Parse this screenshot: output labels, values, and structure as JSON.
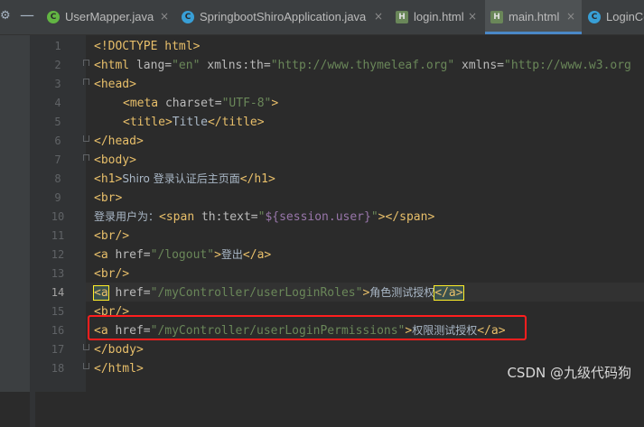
{
  "tabs": [
    {
      "label": "UserMapper.java",
      "icon": "class-icon",
      "icon_char": "C",
      "icon_color": "#62b543",
      "active": false
    },
    {
      "label": "SpringbootShiroApplication.java",
      "icon": "spring-class-icon",
      "icon_char": "C",
      "icon_color": "#389fd6",
      "active": false
    },
    {
      "label": "login.html",
      "icon": "html-file-icon",
      "icon_char": "H",
      "icon_color": "#6a8759",
      "active": false
    },
    {
      "label": "main.html",
      "icon": "html-file-icon",
      "icon_char": "H",
      "icon_color": "#6a8759",
      "active": true
    },
    {
      "label": "LoginCo",
      "icon": "class-icon",
      "icon_char": "C",
      "icon_color": "#389fd6",
      "active": false
    }
  ],
  "tab_close_glyph": "×",
  "line_numbers": [
    "1",
    "2",
    "3",
    "4",
    "5",
    "6",
    "7",
    "8",
    "9",
    "10",
    "11",
    "12",
    "13",
    "14",
    "15",
    "16",
    "17",
    "18"
  ],
  "current_line": "14",
  "code": {
    "l1": "<!DOCTYPE html>",
    "l2_tag": "<html",
    "l2_attr1": " lang=",
    "l2_val1": "\"en\"",
    "l2_attr2": " xmlns:th=",
    "l2_val2": "\"http://www.thymeleaf.org\"",
    "l2_attr3": " xmlns=",
    "l2_val3": "\"http://www.w3.org",
    "l3": "<head>",
    "l4_tag": "<meta",
    "l4_attr": " charset=",
    "l4_val": "\"UTF-8\"",
    "l4_end": ">",
    "l5_open": "<title>",
    "l5_text": "Title",
    "l5_close": "</title>",
    "l6": "</head>",
    "l7": "<body>",
    "l8_open": "<h1>",
    "l8_text": "Shiro 登录认证后主页面",
    "l8_close": "</h1>",
    "l9": "<br>",
    "l10_text": "登录用户为：",
    "l10_tag": "<span",
    "l10_attr": " th:text=",
    "l10_q1": "\"",
    "l10_expr": "${session.user}",
    "l10_q2": "\"",
    "l10_end": "></span>",
    "l11": "<br/>",
    "l12_tag": "<a",
    "l12_attr": " href=",
    "l12_val": "\"/logout\"",
    "l12_gt": ">",
    "l12_text": "登出",
    "l12_close": "</a>",
    "l13": "<br/>",
    "l14_tag": "<a",
    "l14_attr": " href=",
    "l14_val": "\"/myController/userLoginRoles\"",
    "l14_gt": ">",
    "l14_text": "角色测试授权",
    "l14_close": "</a>",
    "l15": "<br/>",
    "l16_tag": "<a",
    "l16_attr": " href=",
    "l16_val": "\"/myController/userLoginPermissions\"",
    "l16_gt": ">",
    "l16_text": "权限测试授权",
    "l16_close": "</a>",
    "l17": "</body>",
    "l18": "</html>"
  },
  "watermark": "CSDN @九级代码狗",
  "colors": {
    "background": "#2b2b2b",
    "tag": "#e8bf6a",
    "string": "#6a8759",
    "highlight_box": "#ff1e1e"
  }
}
